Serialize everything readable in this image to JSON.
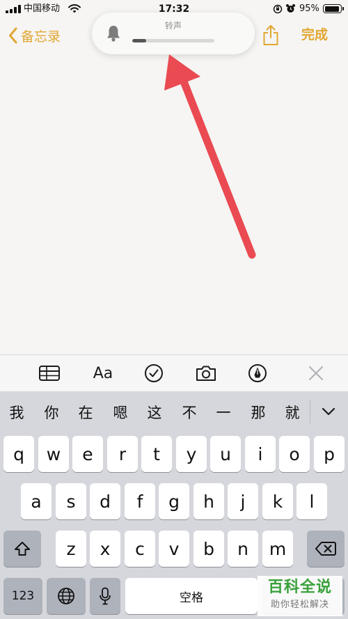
{
  "status_bar": {
    "carrier": "中国移动",
    "time": "17:32",
    "battery_text": "95%",
    "battery_level": 0.95,
    "icons": [
      "signal-icon",
      "wifi-icon",
      "orientation-lock-icon",
      "alarm-icon",
      "battery-icon"
    ]
  },
  "nav": {
    "back_label": "备忘录",
    "done_label": "完成",
    "accent_color": "#e1a632",
    "icons": [
      "chevron-left-icon",
      "share-icon"
    ]
  },
  "volume_hud": {
    "label": "铃声",
    "level": 0.17,
    "icon": "bell-icon"
  },
  "annotation": {
    "color": "#ea4a52",
    "icon": "arrow-icon"
  },
  "toolbar": {
    "format_label": "Aa",
    "icons": [
      "table-icon",
      "text-format-icon",
      "checklist-icon",
      "camera-icon",
      "markup-pen-icon",
      "close-icon"
    ]
  },
  "candidates": {
    "items": [
      "我",
      "你",
      "在",
      "嗯",
      "这",
      "不",
      "一",
      "那",
      "就"
    ],
    "expand_icon": "chevron-down-icon"
  },
  "keyboard": {
    "row1": [
      "q",
      "w",
      "e",
      "r",
      "t",
      "y",
      "u",
      "i",
      "o",
      "p"
    ],
    "row2": [
      "a",
      "s",
      "d",
      "f",
      "g",
      "h",
      "j",
      "k",
      "l"
    ],
    "row3": [
      "z",
      "x",
      "c",
      "v",
      "b",
      "n",
      "m"
    ],
    "numbers_label": "123",
    "space_label": "空格",
    "icons": [
      "shift-icon",
      "backspace-icon",
      "globe-icon",
      "microphone-icon"
    ]
  },
  "watermark": {
    "title": "百科全说",
    "subtitle": "助你轻松解决"
  }
}
